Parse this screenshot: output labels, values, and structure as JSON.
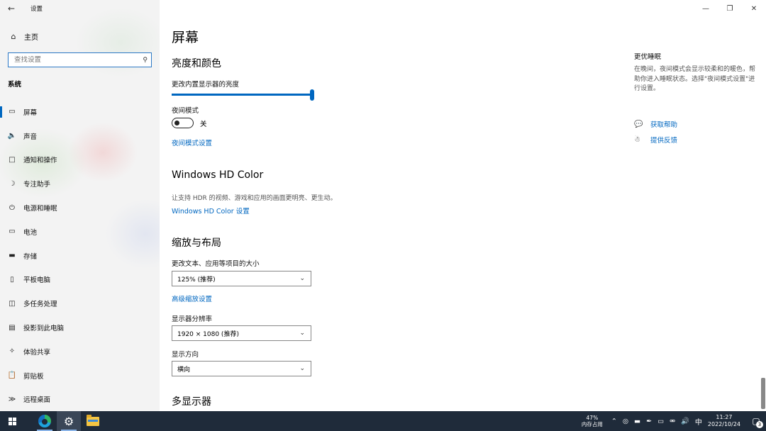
{
  "window": {
    "title": "设置"
  },
  "sidebar": {
    "home": {
      "label": "主页"
    },
    "search_placeholder": "查找设置",
    "section": "系统",
    "items": [
      {
        "label": "屏幕",
        "icon": "monitor-icon",
        "active": true
      },
      {
        "label": "声音",
        "icon": "speaker-icon"
      },
      {
        "label": "通知和操作",
        "icon": "notification-icon"
      },
      {
        "label": "专注助手",
        "icon": "moon-icon"
      },
      {
        "label": "电源和睡眠",
        "icon": "power-icon"
      },
      {
        "label": "电池",
        "icon": "battery-icon"
      },
      {
        "label": "存储",
        "icon": "storage-icon"
      },
      {
        "label": "平板电脑",
        "icon": "tablet-icon"
      },
      {
        "label": "多任务处理",
        "icon": "multitask-icon"
      },
      {
        "label": "投影到此电脑",
        "icon": "project-icon"
      },
      {
        "label": "体验共享",
        "icon": "share-icon"
      },
      {
        "label": "剪贴板",
        "icon": "clipboard-icon"
      },
      {
        "label": "远程桌面",
        "icon": "remote-desktop-icon"
      }
    ]
  },
  "main": {
    "title": "屏幕",
    "brightness": {
      "heading": "亮度和颜色",
      "slider_label": "更改内置显示器的亮度",
      "value": 100
    },
    "night_light": {
      "label": "夜间模式",
      "state": "关",
      "settings_link": "夜间模式设置"
    },
    "hd_color": {
      "heading": "Windows HD Color",
      "desc": "让支持 HDR 的视频、游戏和应用的画面更明亮、更生动。",
      "link": "Windows HD Color 设置"
    },
    "scale_layout": {
      "heading": "缩放与布局",
      "scale_label": "更改文本、应用等项目的大小",
      "scale_value": "125% (推荐)",
      "advanced_link": "高级缩放设置",
      "resolution_label": "显示器分辨率",
      "resolution_value": "1920 × 1080 (推荐)",
      "orientation_label": "显示方向",
      "orientation_value": "横向"
    },
    "multi_display": {
      "heading": "多显示器"
    }
  },
  "right_panel": {
    "title": "更优睡眠",
    "desc": "在晚间，夜间模式会显示较柔和的暖色，帮助你进入睡眠状态。选择\"夜间模式设置\"进行设置。",
    "help_link": "获取帮助",
    "feedback_link": "提供反馈"
  },
  "taskbar": {
    "memory_percent": "47%",
    "memory_label": "内存占用",
    "ime": "中",
    "time": "11:27",
    "date": "2022/10/24",
    "notification_count": "3"
  },
  "colors": {
    "accent": "#0067c0",
    "taskbar": "#1f2b3a",
    "sidebar": "#f3f3f3"
  }
}
